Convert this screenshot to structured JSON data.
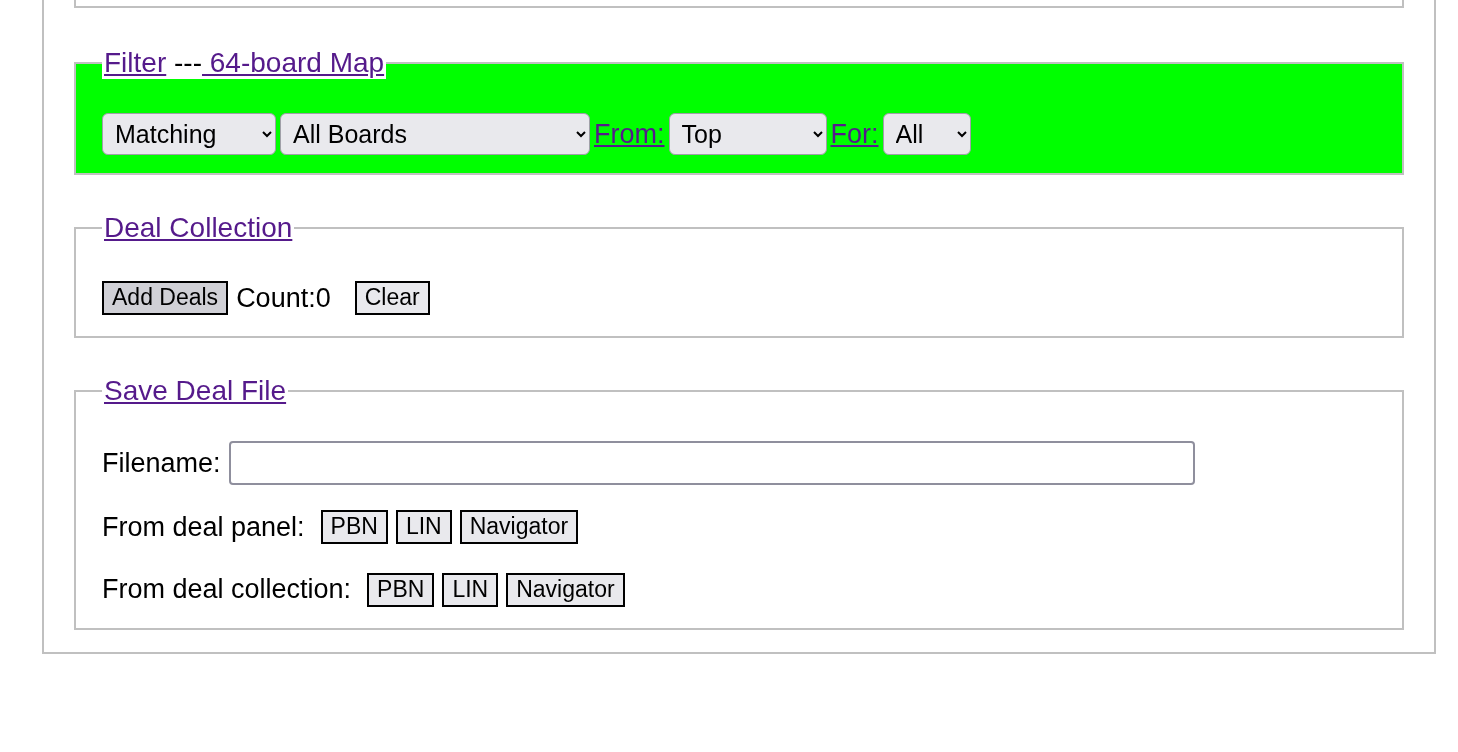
{
  "filter": {
    "legend_links": [
      "Filter",
      " 64-board Map"
    ],
    "separator": "---",
    "selects": [
      {
        "kind": "select",
        "value": "Matching"
      },
      {
        "kind": "select",
        "value": "All Boards"
      },
      {
        "kind": "link",
        "label": "From:"
      },
      {
        "kind": "select",
        "value": "Top"
      },
      {
        "kind": "link",
        "label": "For:"
      },
      {
        "kind": "select",
        "value": "All"
      }
    ]
  },
  "deal_collection": {
    "legend": "Deal Collection",
    "add_button": {
      "label": "Add Deals",
      "pressed": true
    },
    "count": "Count:0",
    "clear_button": {
      "label": "Clear",
      "pressed": false
    }
  },
  "save_deal_file": {
    "legend": "Save Deal File",
    "filename": {
      "label": "Filename:"
    },
    "rows": [
      {
        "label": "From deal panel:",
        "buttons": [
          "PBN",
          "LIN",
          "Navigator"
        ]
      },
      {
        "label": "From deal collection:",
        "buttons": [
          "PBN",
          "LIN",
          "Navigator"
        ]
      }
    ]
  }
}
